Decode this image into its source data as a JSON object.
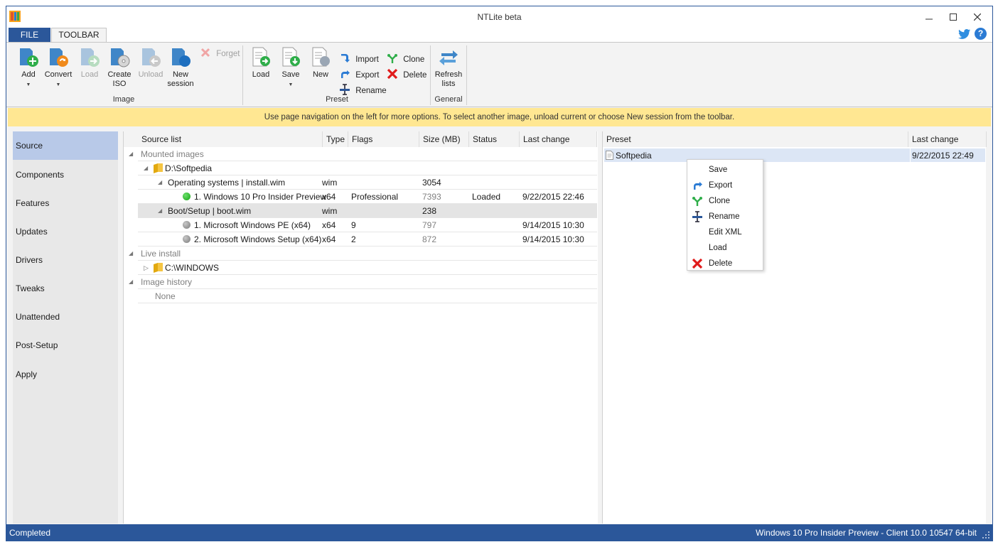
{
  "window": {
    "title": "NTLite beta"
  },
  "tabs": {
    "file": "FILE",
    "toolbar": "TOOLBAR"
  },
  "ribbon": {
    "image_group": {
      "label": "Image",
      "add": "Add",
      "convert": "Convert",
      "load": "Load",
      "create_iso": "Create ISO",
      "unload": "Unload",
      "new_session": "New session",
      "forget": "Forget"
    },
    "preset_group": {
      "label": "Preset",
      "load": "Load",
      "save": "Save",
      "new": "New",
      "import": "Import",
      "export": "Export",
      "rename": "Rename",
      "clone": "Clone",
      "delete": "Delete"
    },
    "general_group": {
      "label": "General",
      "refresh": "Refresh lists"
    }
  },
  "infobar": {
    "text": "Use page navigation on the left for more options. To select another image, unload current or choose New session from the toolbar."
  },
  "nav": {
    "items": [
      "Source",
      "Components",
      "Features",
      "Updates",
      "Drivers",
      "Tweaks",
      "Unattended",
      "Post-Setup",
      "Apply"
    ],
    "active": "Source"
  },
  "source_table": {
    "columns": [
      "Source list",
      "Type",
      "Flags",
      "Size (MB)",
      "Status",
      "Last change"
    ],
    "mounted_images": "Mounted images",
    "folder_softpedia": "D:\\Softpedia",
    "os_row": {
      "name": "Operating systems  |  install.wim",
      "type": "wim",
      "size": "3054"
    },
    "win10_row": {
      "name": "1. Windows 10 Pro Insider Preview",
      "type": "x64",
      "flags": "Professional",
      "size": "7393",
      "status": "Loaded",
      "last_change": "9/22/2015 22:46"
    },
    "boot_row": {
      "name": "Boot/Setup  |  boot.wim",
      "type": "wim",
      "size": "238"
    },
    "pe_row": {
      "name": "1. Microsoft Windows PE (x64)",
      "type": "x64",
      "flags": "9",
      "size": "797",
      "last_change": "9/14/2015 10:30"
    },
    "setup_row": {
      "name": "2. Microsoft Windows Setup (x64)",
      "type": "x64",
      "flags": "2",
      "size": "872",
      "last_change": "9/14/2015 10:30"
    },
    "live_install": "Live install",
    "folder_windows": "C:\\WINDOWS",
    "image_history": "Image history",
    "history_none": "None"
  },
  "preset_table": {
    "columns": [
      "Preset",
      "Last change"
    ],
    "rows": [
      {
        "name": "Softpedia",
        "last_change": "9/22/2015 22:49"
      }
    ]
  },
  "context_menu": {
    "items": [
      "Save",
      "Export",
      "Clone",
      "Rename",
      "Edit XML",
      "Load",
      "Delete"
    ]
  },
  "status": {
    "left": "Completed",
    "right": "Windows 10 Pro Insider Preview - Client 10.0 10547 64-bit"
  },
  "colors": {
    "accent": "#2b579a",
    "infobar": "#ffe792",
    "nav_active": "#b8c9e8",
    "loaded_dot": "#13a313"
  }
}
